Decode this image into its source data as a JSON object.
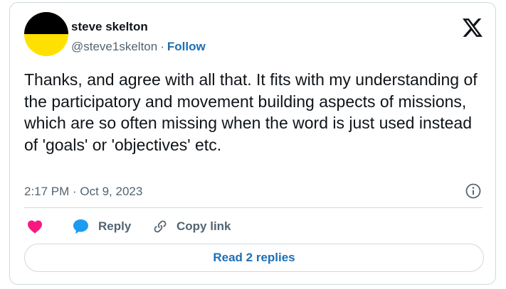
{
  "author": {
    "name": "steve skelton",
    "handle": "@steve1skelton",
    "separator": "·",
    "follow_label": "Follow"
  },
  "tweet": {
    "text": "Thanks, and agree with all that. It fits with my understanding of the participatory and movement building aspects of missions, which are so often missing when the word is just used instead of 'goals' or 'objectives' etc.",
    "timestamp": "2:17 PM · Oct 9, 2023"
  },
  "actions": {
    "reply_label": "Reply",
    "copy_link_label": "Copy link"
  },
  "footer": {
    "read_replies_label": "Read 2 replies"
  },
  "icons": {
    "logo": "x-logo-icon",
    "info": "info-icon",
    "like": "heart-icon",
    "reply": "reply-bubble-icon",
    "copy": "link-icon"
  },
  "colors": {
    "text": "#0f1419",
    "muted": "#536471",
    "link_blue": "#1d6fb5",
    "like_pink": "#f91880",
    "reply_blue": "#1d9bf0",
    "border": "#cfd9de"
  }
}
